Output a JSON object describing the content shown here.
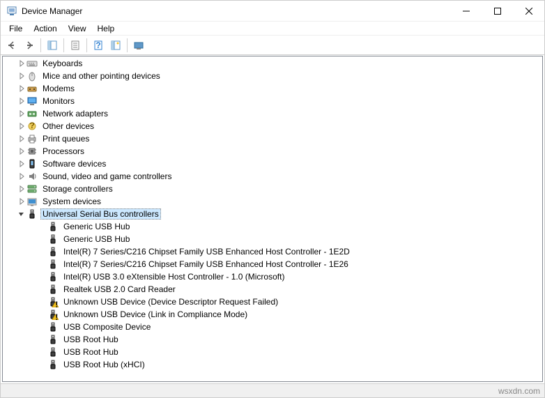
{
  "window": {
    "title": "Device Manager"
  },
  "menubar": {
    "file": "File",
    "action": "Action",
    "view": "View",
    "help": "Help"
  },
  "tree": {
    "categories": [
      {
        "label": "Keyboards",
        "icon": "keyboard",
        "expanded": false
      },
      {
        "label": "Mice and other pointing devices",
        "icon": "mouse",
        "expanded": false
      },
      {
        "label": "Modems",
        "icon": "modem",
        "expanded": false
      },
      {
        "label": "Monitors",
        "icon": "monitor",
        "expanded": false
      },
      {
        "label": "Network adapters",
        "icon": "network",
        "expanded": false
      },
      {
        "label": "Other devices",
        "icon": "other",
        "expanded": false
      },
      {
        "label": "Print queues",
        "icon": "printer",
        "expanded": false
      },
      {
        "label": "Processors",
        "icon": "cpu",
        "expanded": false
      },
      {
        "label": "Software devices",
        "icon": "software",
        "expanded": false
      },
      {
        "label": "Sound, video and game controllers",
        "icon": "sound",
        "expanded": false
      },
      {
        "label": "Storage controllers",
        "icon": "storage",
        "expanded": false
      },
      {
        "label": "System devices",
        "icon": "system",
        "expanded": false
      },
      {
        "label": "Universal Serial Bus controllers",
        "icon": "usb",
        "expanded": true,
        "selected": true
      }
    ],
    "usb_children": [
      {
        "label": "Generic USB Hub",
        "icon": "usb",
        "warn": false
      },
      {
        "label": "Generic USB Hub",
        "icon": "usb",
        "warn": false
      },
      {
        "label": "Intel(R) 7 Series/C216 Chipset Family USB Enhanced Host Controller - 1E2D",
        "icon": "usb",
        "warn": false
      },
      {
        "label": "Intel(R) 7 Series/C216 Chipset Family USB Enhanced Host Controller - 1E26",
        "icon": "usb",
        "warn": false
      },
      {
        "label": "Intel(R) USB 3.0 eXtensible Host Controller - 1.0 (Microsoft)",
        "icon": "usb",
        "warn": false
      },
      {
        "label": "Realtek USB 2.0 Card Reader",
        "icon": "usb",
        "warn": false
      },
      {
        "label": "Unknown USB Device (Device Descriptor Request Failed)",
        "icon": "usb",
        "warn": true
      },
      {
        "label": "Unknown USB Device (Link in Compliance Mode)",
        "icon": "usb",
        "warn": true
      },
      {
        "label": "USB Composite Device",
        "icon": "usb",
        "warn": false
      },
      {
        "label": "USB Root Hub",
        "icon": "usb",
        "warn": false
      },
      {
        "label": "USB Root Hub",
        "icon": "usb",
        "warn": false
      },
      {
        "label": "USB Root Hub (xHCI)",
        "icon": "usb",
        "warn": false
      }
    ]
  },
  "status": {
    "watermark": "wsxdn.com"
  }
}
